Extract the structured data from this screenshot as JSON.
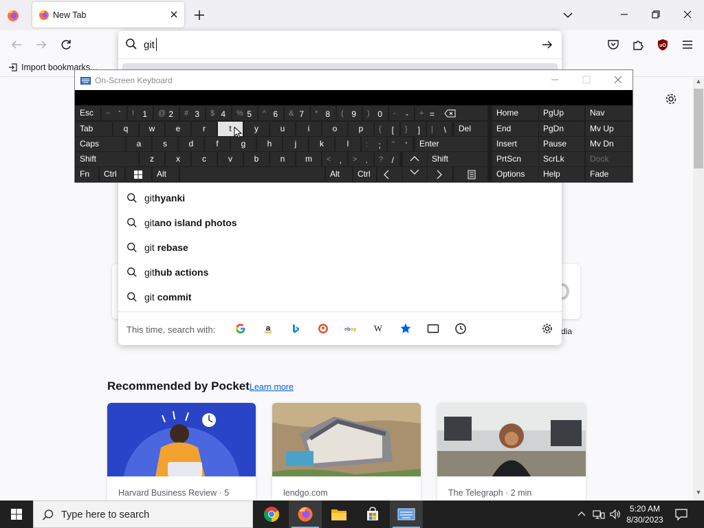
{
  "browser": {
    "tab": {
      "title": "New Tab"
    },
    "bookmarks": {
      "import_label": "Import bookmarks..."
    },
    "urlbar": {
      "value": "git",
      "suggestions": [
        {
          "typed": "git",
          "completion": "hyanki"
        },
        {
          "typed": "git",
          "completion": "ano island photos"
        },
        {
          "typed": "git ",
          "completion": "rebase"
        },
        {
          "typed": "git",
          "completion": "hub actions"
        },
        {
          "typed": "git ",
          "completion": "commit"
        }
      ],
      "search_with_label": "This time, search with:",
      "engines": [
        "google-icon",
        "amazon-icon",
        "bing-icon",
        "duckduckgo-icon",
        "ebay-icon",
        "wikipedia-icon",
        "bookmarks-icon",
        "tabs-icon",
        "history-icon"
      ]
    }
  },
  "newtab": {
    "shortcut_label_right": "dia",
    "pocket": {
      "heading": "Recommended by Pocket",
      "learn_more": "Learn more",
      "cards": [
        {
          "source": "Harvard Business Review · 5"
        },
        {
          "source": "lendgo.com"
        },
        {
          "source": "The Telegraph · 2 min"
        }
      ]
    }
  },
  "osk": {
    "title": "On-Screen Keyboard",
    "keys": {
      "esc": "Esc",
      "tab": "Tab",
      "caps": "Caps",
      "shift": "Shift",
      "fn": "Fn",
      "ctrl": "Ctrl",
      "alt": "Alt",
      "del": "Del",
      "enter": "Enter",
      "options": "Options",
      "help": "Help",
      "fade": "Fade",
      "home": "Home",
      "pgup": "PgUp",
      "nav": "Nav",
      "end": "End",
      "pgdn": "PgDn",
      "mvup": "Mv Up",
      "insert": "Insert",
      "pause": "Pause",
      "mvdn": "Mv Dn",
      "prtscn": "PrtScn",
      "scrlk": "ScrLk",
      "dock": "Dock",
      "num_row": [
        {
          "sh": "~",
          "mn": "`"
        },
        {
          "sh": "!",
          "mn": "1"
        },
        {
          "sh": "@",
          "mn": "2"
        },
        {
          "sh": "#",
          "mn": "3"
        },
        {
          "sh": "$",
          "mn": "4"
        },
        {
          "sh": "%",
          "mn": "5"
        },
        {
          "sh": "^",
          "mn": "6"
        },
        {
          "sh": "&",
          "mn": "7"
        },
        {
          "sh": "*",
          "mn": "8"
        },
        {
          "sh": "(",
          "mn": "9"
        },
        {
          "sh": ")",
          "mn": "0"
        },
        {
          "sh": "-",
          "mn": "-"
        },
        {
          "sh": "+",
          "mn": "="
        }
      ],
      "row_q": [
        "q",
        "w",
        "e",
        "r",
        "t",
        "y",
        "u",
        "i",
        "o",
        "p"
      ],
      "row_q_sym": [
        {
          "sh": "{",
          "mn": "["
        },
        {
          "sh": "}",
          "mn": "]"
        },
        {
          "sh": "|",
          "mn": "\\"
        }
      ],
      "row_a": [
        "a",
        "s",
        "d",
        "f",
        "g",
        "h",
        "j",
        "k",
        "l"
      ],
      "row_a_sym": [
        {
          "sh": ":",
          "mn": ";"
        },
        {
          "sh": "\"",
          "mn": "'"
        }
      ],
      "row_z": [
        "z",
        "x",
        "c",
        "v",
        "b",
        "n",
        "m"
      ],
      "row_z_sym": [
        {
          "sh": "<",
          "mn": ","
        },
        {
          "sh": ">",
          "mn": "."
        },
        {
          "sh": "?",
          "mn": "/"
        }
      ],
      "active_key": "t"
    }
  },
  "taskbar": {
    "search_placeholder": "Type here to search",
    "time": "5:20 AM",
    "date": "8/30/2023",
    "apps": [
      "chrome-icon",
      "firefox-icon",
      "file-explorer-icon",
      "microsoft-store-icon",
      "on-screen-keyboard-icon"
    ]
  },
  "colors": {
    "accent": "#0061e0",
    "keyboard_bg": "#1f1f1f",
    "key_bg": "#2b2b2b",
    "taskbar_bg": "#202020"
  }
}
